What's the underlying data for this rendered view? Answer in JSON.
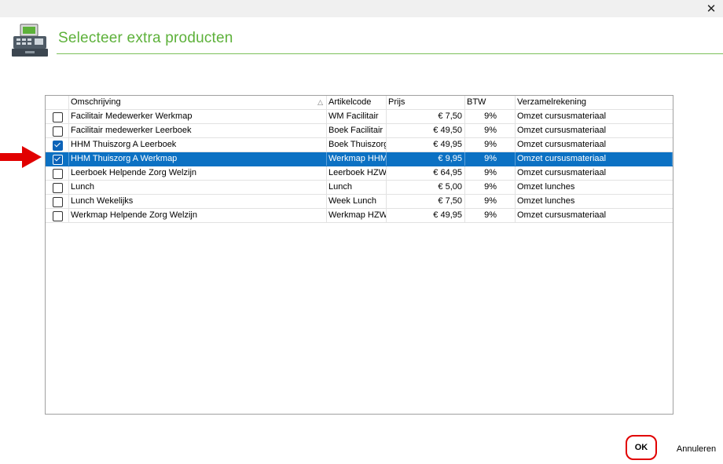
{
  "dialog": {
    "title": "Selecteer extra producten",
    "close_icon": "close-icon",
    "header_icon": "cash-register-icon",
    "accent_color": "#5db13a",
    "selection_color": "#0c71c3"
  },
  "grid": {
    "columns": {
      "omschrijving": "Omschrijving",
      "artikelcode": "Artikelcode",
      "prijs": "Prijs",
      "btw": "BTW",
      "verzamelrekening": "Verzamelrekening"
    },
    "sort_indicator": "△",
    "rows": [
      {
        "checked": false,
        "selected": false,
        "omschrijving": "Facilitair Medewerker Werkmap",
        "artikelcode": "WM Facilitair",
        "prijs": "€ 7,50",
        "btw": "9%",
        "verzamelrekening": "Omzet cursusmateriaal"
      },
      {
        "checked": false,
        "selected": false,
        "omschrijving": "Facilitair medewerker Leerboek",
        "artikelcode": "Boek Facilitair",
        "prijs": "€ 49,50",
        "btw": "9%",
        "verzamelrekening": "Omzet cursusmateriaal"
      },
      {
        "checked": true,
        "selected": false,
        "omschrijving": "HHM Thuiszorg A Leerboek",
        "artikelcode": "Boek Thuiszorg",
        "prijs": "€ 49,95",
        "btw": "9%",
        "verzamelrekening": "Omzet cursusmateriaal"
      },
      {
        "checked": true,
        "selected": true,
        "omschrijving": "HHM Thuiszorg A Werkmap",
        "artikelcode": "Werkmap HHM",
        "prijs": "€ 9,95",
        "btw": "9%",
        "verzamelrekening": "Omzet cursusmateriaal"
      },
      {
        "checked": false,
        "selected": false,
        "omschrijving": "Leerboek Helpende Zorg Welzijn",
        "artikelcode": "Leerboek HZW",
        "prijs": "€ 64,95",
        "btw": "9%",
        "verzamelrekening": "Omzet cursusmateriaal"
      },
      {
        "checked": false,
        "selected": false,
        "omschrijving": "Lunch",
        "artikelcode": "Lunch",
        "prijs": "€ 5,00",
        "btw": "9%",
        "verzamelrekening": "Omzet lunches"
      },
      {
        "checked": false,
        "selected": false,
        "omschrijving": "Lunch Wekelijks",
        "artikelcode": "Week Lunch",
        "prijs": "€ 7,50",
        "btw": "9%",
        "verzamelrekening": "Omzet lunches"
      },
      {
        "checked": false,
        "selected": false,
        "omschrijving": "Werkmap Helpende Zorg Welzijn",
        "artikelcode": "Werkmap HZW",
        "prijs": "€ 49,95",
        "btw": "9%",
        "verzamelrekening": "Omzet cursusmateriaal"
      }
    ]
  },
  "annotation": {
    "arrow_icon": "red-arrow-icon",
    "color": "#e10000"
  },
  "buttons": {
    "ok_label": "OK",
    "cancel_label": "Annuleren"
  }
}
